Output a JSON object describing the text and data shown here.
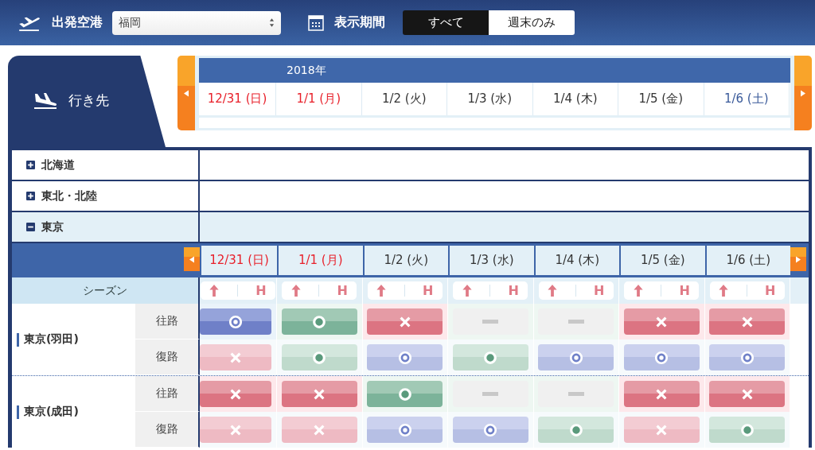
{
  "header": {
    "departure_label": "出発空港",
    "departure_value": "福岡",
    "period_label": "表示期間",
    "period_options": [
      {
        "label": "すべて",
        "selected": true
      },
      {
        "label": "週末のみ",
        "selected": false
      }
    ]
  },
  "destination_tab": {
    "label": "行き先"
  },
  "calendar": {
    "year": "2018年",
    "dates": [
      {
        "label": "12/31 (日)",
        "color": "#e8202a"
      },
      {
        "label": "1/1 (月)",
        "color": "#e8202a"
      },
      {
        "label": "1/2 (火)",
        "color": "#333333"
      },
      {
        "label": "1/3 (水)",
        "color": "#333333"
      },
      {
        "label": "1/4 (木)",
        "color": "#333333"
      },
      {
        "label": "1/5 (金)",
        "color": "#333333"
      },
      {
        "label": "1/6 (土)",
        "color": "#3a5a9a"
      }
    ]
  },
  "regions": [
    {
      "name": "北海道",
      "expanded": false
    },
    {
      "name": "東北・北陸",
      "expanded": false
    },
    {
      "name": "東京",
      "expanded": true
    }
  ],
  "detail": {
    "dates": [
      {
        "label": "12/31 (日)",
        "color": "#e8202a"
      },
      {
        "label": "1/1 (月)",
        "color": "#e8202a"
      },
      {
        "label": "1/2 (火)",
        "color": "#333333"
      },
      {
        "label": "1/3 (水)",
        "color": "#333333"
      },
      {
        "label": "1/4 (木)",
        "color": "#333333"
      },
      {
        "label": "1/5 (金)",
        "color": "#333333"
      },
      {
        "label": "1/6 (土)",
        "color": "#333333"
      }
    ],
    "season_label": "シーズン",
    "season_marks": [
      "H",
      "H",
      "H",
      "H",
      "H",
      "H",
      "H"
    ],
    "airports": [
      {
        "name": "東京(羽田)",
        "routes": [
          {
            "direction": "往路",
            "emphasis": true,
            "cells": [
              {
                "kind": "double_circle"
              },
              {
                "kind": "circle"
              },
              {
                "kind": "cross"
              },
              {
                "kind": "dash"
              },
              {
                "kind": "dash"
              },
              {
                "kind": "cross"
              },
              {
                "kind": "cross"
              }
            ]
          },
          {
            "direction": "復路",
            "emphasis": false,
            "cells": [
              {
                "kind": "cross"
              },
              {
                "kind": "circle"
              },
              {
                "kind": "double_circle"
              },
              {
                "kind": "circle"
              },
              {
                "kind": "double_circle"
              },
              {
                "kind": "double_circle"
              },
              {
                "kind": "double_circle"
              }
            ]
          }
        ]
      },
      {
        "name": "東京(成田)",
        "routes": [
          {
            "direction": "往路",
            "emphasis": true,
            "cells": [
              {
                "kind": "cross"
              },
              {
                "kind": "cross"
              },
              {
                "kind": "circle"
              },
              {
                "kind": "dash"
              },
              {
                "kind": "dash"
              },
              {
                "kind": "cross"
              },
              {
                "kind": "cross"
              }
            ]
          },
          {
            "direction": "復路",
            "emphasis": false,
            "cells": [
              {
                "kind": "cross"
              },
              {
                "kind": "cross"
              },
              {
                "kind": "double_circle"
              },
              {
                "kind": "double_circle"
              },
              {
                "kind": "circle"
              },
              {
                "kind": "cross"
              },
              {
                "kind": "circle"
              }
            ]
          }
        ]
      }
    ]
  }
}
